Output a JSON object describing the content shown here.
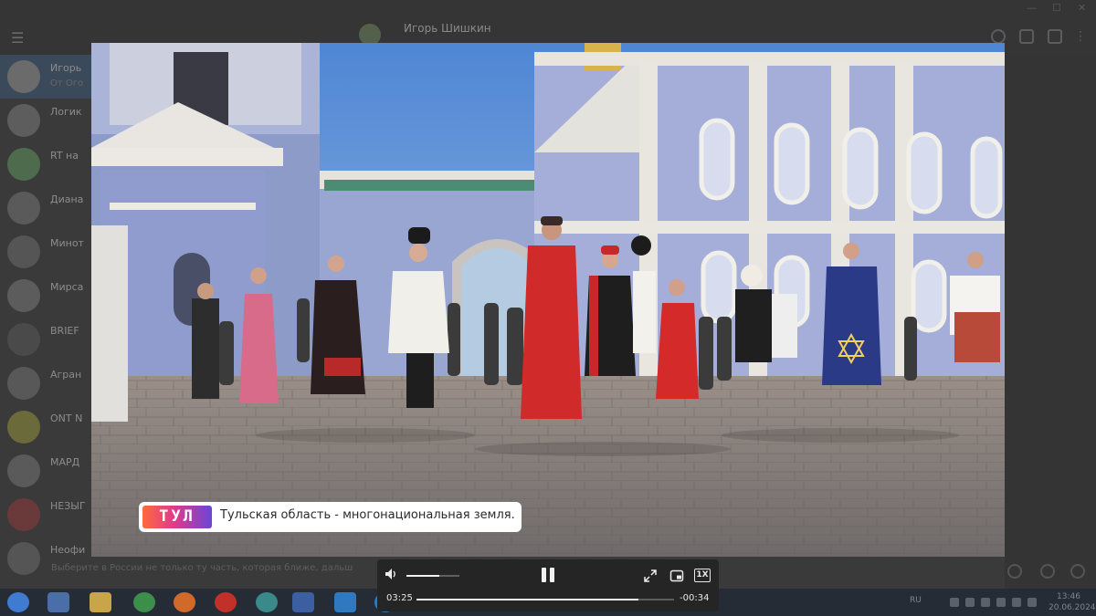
{
  "background_app": {
    "chat_title": "Игорь Шишкин",
    "menu_icon": "hamburger-icon",
    "chats": [
      {
        "title": "Игорь",
        "subtitle": "От Ого"
      },
      {
        "title": "Логик",
        "subtitle": ""
      },
      {
        "title": "RT на",
        "subtitle": ""
      },
      {
        "title": "Диана",
        "subtitle": ""
      },
      {
        "title": "Минот",
        "subtitle": ""
      },
      {
        "title": "Мирса",
        "subtitle": ""
      },
      {
        "title": "BRIEF",
        "subtitle": ""
      },
      {
        "title": "Агран",
        "subtitle": ""
      },
      {
        "title": "ONT N",
        "subtitle": ""
      },
      {
        "title": "МАРД",
        "subtitle": ""
      },
      {
        "title": "НЕЗЫГ",
        "subtitle": ""
      },
      {
        "title": "Неофи",
        "subtitle": ""
      }
    ],
    "input_preview": "Выберите в России не только ту часть, которая ближе, дальше"
  },
  "taskbar": {
    "language": "RU",
    "time": "13:46",
    "date": "20.06.2024"
  },
  "video": {
    "caption": {
      "logo_text": "ТУЛ",
      "text": "Тульская область - многонациональная земля."
    }
  },
  "player": {
    "volume_level": 0.62,
    "progress_fraction": 0.86,
    "time_elapsed": "03:25",
    "time_remaining": "-00:34",
    "speed_label": "1X",
    "colors": {
      "panel": "#252525",
      "accent": "#f0f0f0"
    }
  }
}
